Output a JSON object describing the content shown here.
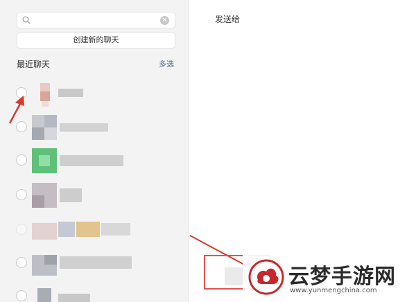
{
  "search": {
    "value": "",
    "placeholder": ""
  },
  "left_panel": {
    "new_chat_label": "创建新的聊天",
    "recent_title": "最近聊天",
    "multi_select_label": "多选"
  },
  "right_panel": {
    "title": "发送给"
  },
  "colors": {
    "accent_link": "#576b95",
    "arrow_red": "#d9382f",
    "highlight_border": "#e35050"
  },
  "watermark": {
    "name": "云梦手游网",
    "url": "www.yunmengchina.com"
  }
}
